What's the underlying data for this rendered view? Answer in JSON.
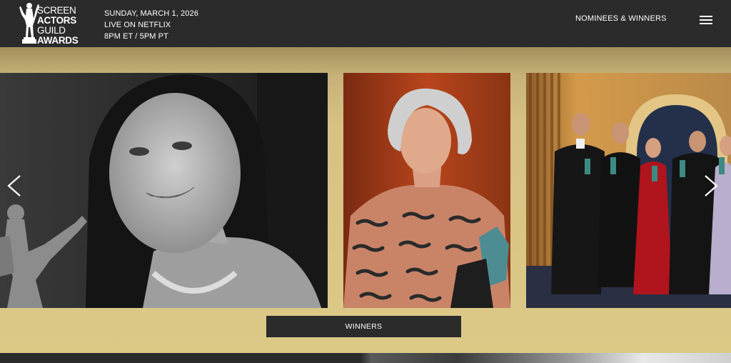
{
  "header": {
    "logo": {
      "line1": "SCREEN",
      "line2": "ACTORS",
      "line3": "GUILD",
      "line4": "AWARDS",
      "icon": "actor-statuette-icon"
    },
    "event": {
      "date": "SUNDAY, MARCH 1, 2026",
      "broadcast": "LIVE ON NETFLIX",
      "time": "8PM ET / 5PM PT"
    },
    "nav_label": "NOMINEES & WINNERS",
    "menu_icon": "hamburger-menu-icon"
  },
  "carousel": {
    "slides": [
      {
        "kind": "portrait-bw"
      },
      {
        "kind": "portrait-color"
      },
      {
        "kind": "group-photo"
      }
    ],
    "prev_icon": "chevron-left-icon",
    "next_icon": "chevron-right-icon",
    "cta_label": "WINNERS"
  },
  "colors": {
    "header_bg": "#2b2b2b",
    "gold": "#d6c283",
    "text": "#ffffff"
  }
}
